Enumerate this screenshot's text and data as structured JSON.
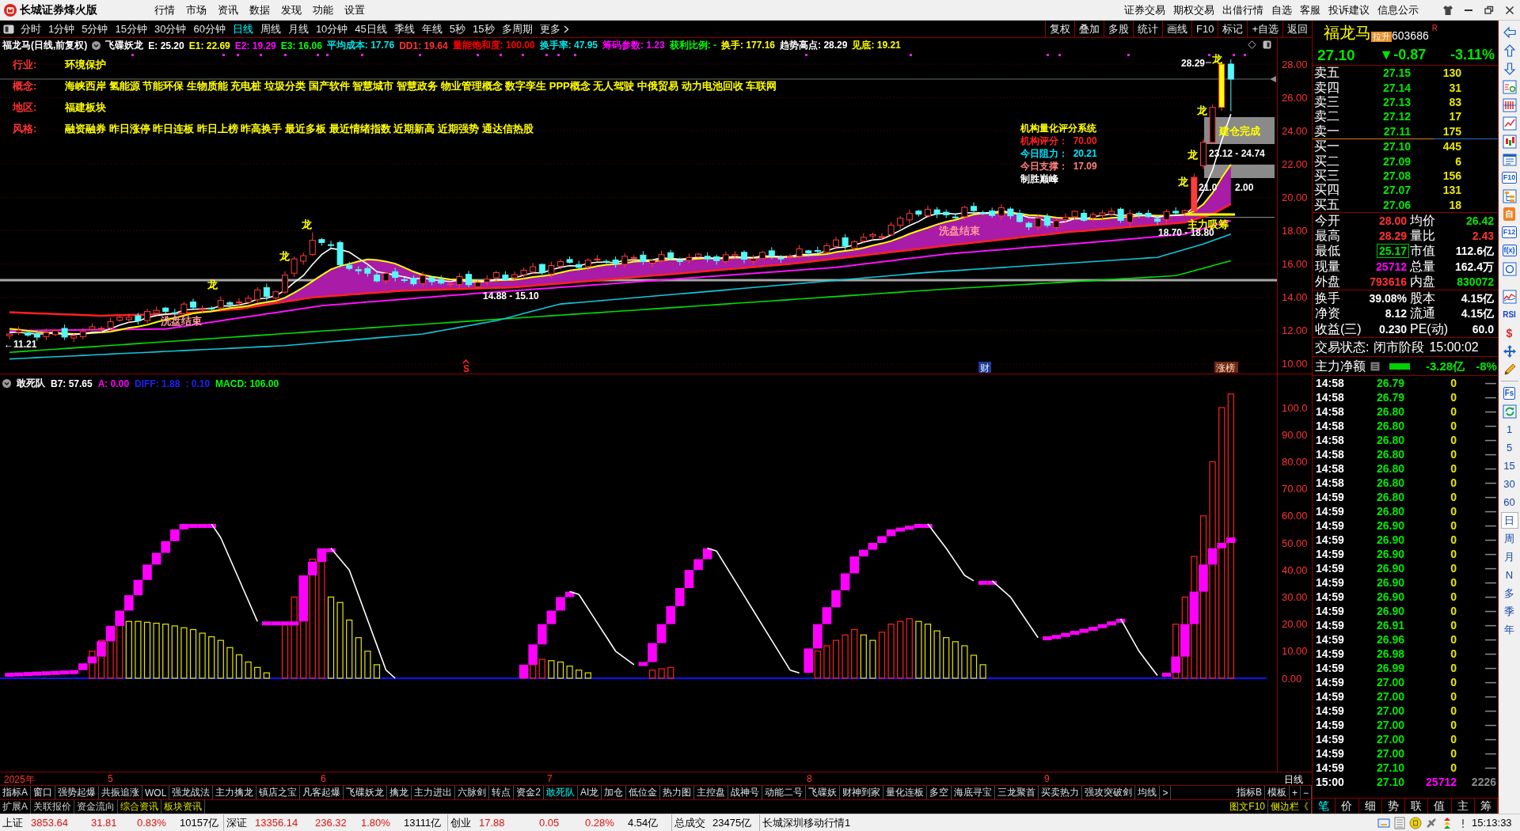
{
  "window": {
    "app_name": "长城证券烽火版",
    "menu": [
      "行情",
      "市场",
      "资讯",
      "数据",
      "发现",
      "功能",
      "设置"
    ],
    "links": [
      "证券交易",
      "期权交易",
      "出借行情",
      "自选",
      "客服",
      "投诉建议",
      "信息公示"
    ]
  },
  "period_tabs": [
    {
      "label": "分时",
      "selected": false
    },
    {
      "label": "1分钟",
      "selected": false
    },
    {
      "label": "5分钟",
      "selected": false
    },
    {
      "label": "15分钟",
      "selected": false
    },
    {
      "label": "30分钟",
      "selected": false
    },
    {
      "label": "60分钟",
      "selected": false
    },
    {
      "label": "日线",
      "selected": true
    },
    {
      "label": "周线",
      "selected": false
    },
    {
      "label": "月线",
      "selected": false
    },
    {
      "label": "10分钟",
      "selected": false
    },
    {
      "label": "45日线",
      "selected": false
    },
    {
      "label": "季线",
      "selected": false
    },
    {
      "label": "年线",
      "selected": false
    },
    {
      "label": "5秒",
      "selected": false
    },
    {
      "label": "15秒",
      "selected": false
    },
    {
      "label": "多周期",
      "selected": false
    },
    {
      "label": "更多",
      "selected": false
    }
  ],
  "chart_tools": [
    "复权",
    "叠加",
    "多股",
    "统计",
    "画线",
    "F10",
    "标记",
    "+自选",
    "返回"
  ],
  "main_chart": {
    "title": "福龙马(日线,前复权)",
    "formula": "飞碟妖龙",
    "values": [
      {
        "text": "E: 25.20",
        "color": "#ffffff"
      },
      {
        "text": "E1: 22.69",
        "color": "#ffff00"
      },
      {
        "text": "E2: 19.29",
        "color": "#ff00ff"
      },
      {
        "text": "E3: 16.06",
        "color": "#00ff00"
      },
      {
        "text": "平均成本: 17.76",
        "color": "#00e5e5"
      },
      {
        "text": "DD1: 19.64",
        "color": "#ff3232"
      },
      {
        "text": "量能饱和度: 100.00",
        "color": "#ff0000"
      },
      {
        "text": "换手率: 47.95",
        "color": "#00e5e5"
      },
      {
        "text": "筹码参数: 1.23",
        "color": "#ff00ff"
      },
      {
        "text": "获利比例: -",
        "color": "#00ff00"
      },
      {
        "text": "换手: 177.16",
        "color": "#ffff00"
      },
      {
        "text": "趋势高点: 28.29",
        "color": "#ffffff"
      },
      {
        "text": "见底: 19.21",
        "color": "#ffff00"
      }
    ],
    "info_rows": [
      {
        "label": "行业:",
        "value": "环境保护"
      },
      {
        "label": "概念:",
        "value": "海峡西岸 氢能源 节能环保 生物质能 充电桩 垃圾分类 国产软件 智慧城市 智慧政务 物业管理概念 数字孪生 PPP概念 无人驾驶 中俄贸易 动力电池回收 车联网"
      },
      {
        "label": "地区:",
        "value": "福建板块"
      },
      {
        "label": "风格:",
        "value": "融资融券 昨日涨停 昨日连板 昨日上榜 昨高换手 最近多板 最近情绪指数 近期新高 近期强势 通达信热股"
      }
    ],
    "price_axis": [
      "28.00",
      "26.00",
      "24.00",
      "22.00",
      "20.00",
      "18.00",
      "16.00",
      "14.00",
      "12.00",
      "10.00"
    ],
    "annotations": [
      {
        "text": "28.29",
        "kind": "price"
      },
      {
        "text": "建仓完成",
        "kind": "zone"
      },
      {
        "text": "23.12 - 24.74",
        "kind": "price"
      },
      {
        "text": "21.0",
        "kind": "price"
      },
      {
        "text": "2.00",
        "kind": "price"
      },
      {
        "text": "主力吸筹",
        "kind": "signal"
      },
      {
        "text": "18.70 - 18.80",
        "kind": "price"
      },
      {
        "text": "洗盘结束",
        "kind": "note"
      },
      {
        "text": "14.88 - 15.10",
        "kind": "price"
      },
      {
        "text": "洗盘结束",
        "kind": "note"
      },
      {
        "text": "←11.21",
        "kind": "price"
      }
    ],
    "dragon_marks": [
      "龙",
      "龙",
      "龙",
      "龙",
      "龙",
      "龙",
      "龙"
    ],
    "score_panel": {
      "title": "机构量化评分系统",
      "rows": [
        {
          "text": "机构评分：  70.00",
          "color": "#ff2020"
        },
        {
          "text": "今日阻力：  20.21",
          "color": "#00e5ff"
        },
        {
          "text": "今日支撑：  17.09",
          "color": "#ff8080"
        }
      ],
      "footer": "制胜巅峰"
    },
    "events": [
      {
        "text": "S",
        "kind": "signal"
      },
      {
        "text": "财",
        "kind": "finance"
      },
      {
        "text": "涨榜",
        "kind": "rank"
      }
    ]
  },
  "sub_chart": {
    "title": "敢死队",
    "values": [
      {
        "text": "B7: 57.65",
        "color": "#ffffff"
      },
      {
        "text": "A: 0.00",
        "color": "#ff00ff"
      },
      {
        "text": "DIFF: 1.88",
        "color": "#2020ff"
      },
      {
        "text": ": 0.10",
        "color": "#2020ff"
      },
      {
        "text": "MACD: 106.00",
        "color": "#00ff00"
      }
    ],
    "axis": [
      "100.0",
      "90.00",
      "80.00",
      "70.00",
      "60.00",
      "50.00",
      "40.00",
      "30.00",
      "20.00",
      "10.00",
      "0.00"
    ]
  },
  "date_axis": {
    "labels": [
      "2025年",
      "5",
      "6",
      "7",
      "8",
      "9"
    ],
    "period": "日线"
  },
  "indicator_tabs": [
    {
      "label": "指标A",
      "selected": false
    },
    {
      "label": "窗口",
      "selected": false
    },
    {
      "label": "强势起爆",
      "selected": false
    },
    {
      "label": "共振追涨",
      "selected": false
    },
    {
      "label": "WOL",
      "selected": false
    },
    {
      "label": "强龙战法",
      "selected": false
    },
    {
      "label": "主力擒龙",
      "selected": false
    },
    {
      "label": "镇店之宝",
      "selected": false
    },
    {
      "label": "凡客起爆",
      "selected": false
    },
    {
      "label": "飞碟妖龙",
      "selected": false
    },
    {
      "label": "擒龙",
      "selected": false
    },
    {
      "label": "主力进出",
      "selected": false
    },
    {
      "label": "六脉剑",
      "selected": false
    },
    {
      "label": "转点",
      "selected": false
    },
    {
      "label": "资金2",
      "selected": false
    },
    {
      "label": "敢死队",
      "selected": true
    },
    {
      "label": "AI龙",
      "selected": false
    },
    {
      "label": "加仓",
      "selected": false
    },
    {
      "label": "低位金",
      "selected": false
    },
    {
      "label": "热力图",
      "selected": false
    },
    {
      "label": "主控盘",
      "selected": false
    },
    {
      "label": "战神号",
      "selected": false
    },
    {
      "label": "动能二号",
      "selected": false
    },
    {
      "label": "飞碟妖",
      "selected": false
    },
    {
      "label": "财神到家",
      "selected": false
    },
    {
      "label": "量化连板",
      "selected": false
    },
    {
      "label": "多空",
      "selected": false
    },
    {
      "label": "海底寻宝",
      "selected": false
    },
    {
      "label": "三龙聚首",
      "selected": false
    },
    {
      "label": "买卖热力",
      "selected": false
    },
    {
      "label": "强攻突破剑",
      "selected": false
    },
    {
      "label": "均线",
      "selected": false
    }
  ],
  "indicator_scroll": ">",
  "indicator_tabs_right": [
    "指标B",
    "模板",
    "+",
    "−"
  ],
  "extra_tabs": [
    {
      "label": "扩展A",
      "highlighted": false
    },
    {
      "label": "关联报价",
      "highlighted": false
    },
    {
      "label": "资金流向",
      "highlighted": false
    },
    {
      "label": "综合资讯",
      "highlighted": true
    },
    {
      "label": "板块资讯",
      "highlighted": true
    }
  ],
  "panel_links": [
    "图文F10",
    "侧边栏《"
  ],
  "quote": {
    "name": "福龙马",
    "tag": "拉升",
    "code": "603686",
    "flag": "R",
    "price": "27.10",
    "change": "▼-0.87",
    "change_pct": "-3.11%"
  },
  "asks": [
    {
      "label": "卖五",
      "price": "27.15",
      "volume": "130"
    },
    {
      "label": "卖四",
      "price": "27.14",
      "volume": "31"
    },
    {
      "label": "卖三",
      "price": "27.13",
      "volume": "83"
    },
    {
      "label": "卖二",
      "price": "27.12",
      "volume": "17"
    },
    {
      "label": "卖一",
      "price": "27.11",
      "volume": "175"
    }
  ],
  "bids": [
    {
      "label": "买一",
      "price": "27.10",
      "volume": "445"
    },
    {
      "label": "买二",
      "price": "27.09",
      "volume": "6"
    },
    {
      "label": "买三",
      "price": "27.08",
      "volume": "156"
    },
    {
      "label": "买四",
      "price": "27.07",
      "volume": "131"
    },
    {
      "label": "买五",
      "price": "27.06",
      "volume": "18"
    }
  ],
  "stats": [
    {
      "label": "今开",
      "value": "28.00",
      "color": "#ff3232",
      "boxed": false
    },
    {
      "label": "均价",
      "value": "26.42",
      "color": "#00e600",
      "boxed": false
    },
    {
      "label": "最高",
      "value": "28.29",
      "color": "#ff3232",
      "boxed": false
    },
    {
      "label": "量比",
      "value": "2.43",
      "color": "#ff3232",
      "boxed": false
    },
    {
      "label": "最低",
      "value": "25.17",
      "color": "#00e600",
      "boxed": true
    },
    {
      "label": "市值",
      "value": "112.6亿",
      "color": "#ffffff",
      "boxed": false
    },
    {
      "label": "现量",
      "value": "25712",
      "color": "#ff00ff",
      "boxed": false
    },
    {
      "label": "总量",
      "value": "162.4万",
      "color": "#ffffff",
      "boxed": false
    },
    {
      "label": "外盘",
      "value": "793616",
      "color": "#ff3232",
      "boxed": false
    },
    {
      "label": "内盘",
      "value": "830072",
      "color": "#00e600",
      "boxed": false
    }
  ],
  "fundamentals": [
    {
      "label": "换手",
      "value": "39.08%"
    },
    {
      "label": "股本",
      "value": "4.15亿"
    },
    {
      "label": "净资",
      "value": "8.12"
    },
    {
      "label": "流通",
      "value": "4.15亿"
    },
    {
      "label": "收益(三)",
      "value": "0.230"
    },
    {
      "label": "PE(动)",
      "value": "60.0"
    }
  ],
  "trade_status": {
    "label": "交易状态:",
    "value": "闭市阶段",
    "time": "15:00:02"
  },
  "main_net": {
    "label": "主力净额",
    "value": "-3.28亿",
    "pct": "-8%"
  },
  "ticks": [
    {
      "time": "14:58",
      "price": "26.79",
      "volume": "0",
      "side": "—",
      "kind": "tick"
    },
    {
      "time": "14:58",
      "price": "26.79",
      "volume": "0",
      "side": "—",
      "kind": "tick"
    },
    {
      "time": "14:58",
      "price": "26.80",
      "volume": "0",
      "side": "—",
      "kind": "tick"
    },
    {
      "time": "14:58",
      "price": "26.80",
      "volume": "0",
      "side": "—",
      "kind": "tick"
    },
    {
      "time": "14:58",
      "price": "26.80",
      "volume": "0",
      "side": "—",
      "kind": "tick"
    },
    {
      "time": "14:58",
      "price": "26.80",
      "volume": "0",
      "side": "—",
      "kind": "tick"
    },
    {
      "time": "14:58",
      "price": "26.80",
      "volume": "0",
      "side": "—",
      "kind": "tick"
    },
    {
      "time": "14:58",
      "price": "26.80",
      "volume": "0",
      "side": "—",
      "kind": "tick"
    },
    {
      "time": "14:59",
      "price": "26.80",
      "volume": "0",
      "side": "—",
      "kind": "tick"
    },
    {
      "time": "14:59",
      "price": "26.80",
      "volume": "0",
      "side": "—",
      "kind": "tick"
    },
    {
      "time": "14:59",
      "price": "26.90",
      "volume": "0",
      "side": "—",
      "kind": "tick"
    },
    {
      "time": "14:59",
      "price": "26.90",
      "volume": "0",
      "side": "—",
      "kind": "tick"
    },
    {
      "time": "14:59",
      "price": "26.90",
      "volume": "0",
      "side": "—",
      "kind": "tick"
    },
    {
      "time": "14:59",
      "price": "26.90",
      "volume": "0",
      "side": "—",
      "kind": "tick"
    },
    {
      "time": "14:59",
      "price": "26.90",
      "volume": "0",
      "side": "—",
      "kind": "tick"
    },
    {
      "time": "14:59",
      "price": "26.90",
      "volume": "0",
      "side": "—",
      "kind": "tick"
    },
    {
      "time": "14:59",
      "price": "26.90",
      "volume": "0",
      "side": "—",
      "kind": "tick"
    },
    {
      "time": "14:59",
      "price": "26.91",
      "volume": "0",
      "side": "—",
      "kind": "tick"
    },
    {
      "time": "14:59",
      "price": "26.96",
      "volume": "0",
      "side": "—",
      "kind": "tick"
    },
    {
      "time": "14:59",
      "price": "26.98",
      "volume": "0",
      "side": "—",
      "kind": "tick"
    },
    {
      "time": "14:59",
      "price": "26.99",
      "volume": "0",
      "side": "—",
      "kind": "tick"
    },
    {
      "time": "14:59",
      "price": "27.00",
      "volume": "0",
      "side": "—",
      "kind": "tick"
    },
    {
      "time": "14:59",
      "price": "27.00",
      "volume": "0",
      "side": "—",
      "kind": "tick"
    },
    {
      "time": "14:59",
      "price": "27.00",
      "volume": "0",
      "side": "—",
      "kind": "tick"
    },
    {
      "time": "14:59",
      "price": "27.00",
      "volume": "0",
      "side": "—",
      "kind": "tick"
    },
    {
      "time": "14:59",
      "price": "27.00",
      "volume": "0",
      "side": "—",
      "kind": "tick"
    },
    {
      "time": "14:59",
      "price": "27.00",
      "volume": "0",
      "side": "—",
      "kind": "tick"
    },
    {
      "time": "14:59",
      "price": "27.10",
      "volume": "0",
      "side": "—",
      "kind": "tick"
    },
    {
      "time": "15:00",
      "price": "27.10",
      "volume": "25712",
      "side": "2226",
      "kind": "close"
    }
  ],
  "quote_tabs": [
    {
      "label": "笔",
      "selected": true
    },
    {
      "label": "价",
      "selected": false
    },
    {
      "label": "细",
      "selected": false
    },
    {
      "label": "势",
      "selected": false
    },
    {
      "label": "联",
      "selected": false
    },
    {
      "label": "值",
      "selected": false
    },
    {
      "label": "主",
      "selected": false
    },
    {
      "label": "筹",
      "selected": false
    }
  ],
  "side_strip": {
    "badges": [
      "F10",
      "自",
      "F12",
      "f(x)",
      "RSI",
      "$",
      "Fs"
    ],
    "periods": [
      {
        "label": "1",
        "selected": false
      },
      {
        "label": "5",
        "selected": false
      },
      {
        "label": "15",
        "selected": false
      },
      {
        "label": "30",
        "selected": false
      },
      {
        "label": "60",
        "selected": false
      },
      {
        "label": "日",
        "selected": true
      },
      {
        "label": "周",
        "selected": false
      },
      {
        "label": "月",
        "selected": false
      },
      {
        "label": "N",
        "selected": false
      },
      {
        "label": "多",
        "selected": false
      },
      {
        "label": "季",
        "selected": false
      },
      {
        "label": "年",
        "selected": false
      }
    ]
  },
  "status_bar": {
    "indices": [
      {
        "name": "上证",
        "value": "3853.64",
        "change": "31.81",
        "pct": "0.83%",
        "amount": "10157亿"
      },
      {
        "name": "深证",
        "value": "13356.14",
        "change": "236.32",
        "pct": "1.80%",
        "amount": "13111亿"
      },
      {
        "name": "创业",
        "value": "17.88",
        "change": "0.05",
        "pct": "0.28%",
        "amount": "4.54亿"
      }
    ],
    "total_label": "总成交",
    "total": "23475亿",
    "server": "长城深圳移动行情1",
    "time": "15:13:33"
  }
}
